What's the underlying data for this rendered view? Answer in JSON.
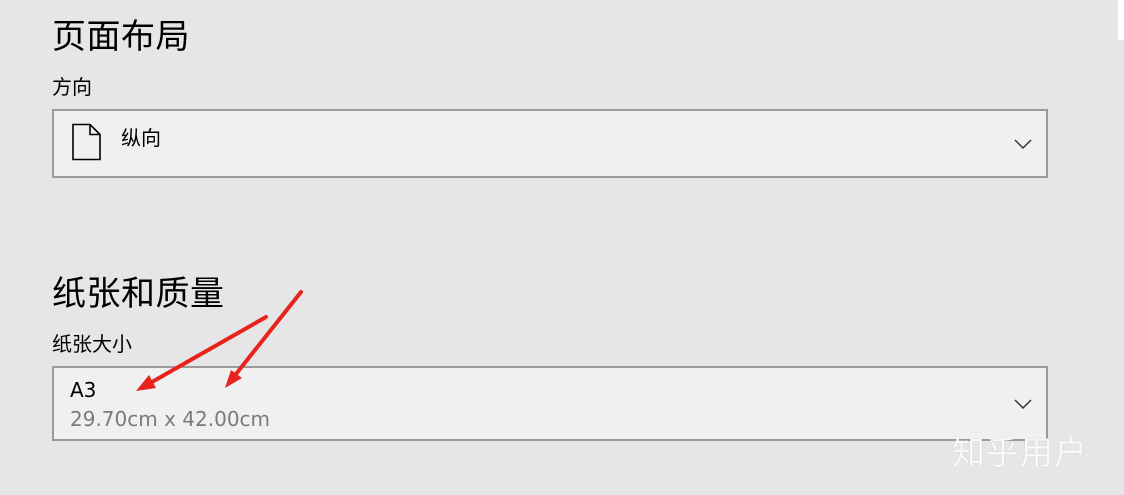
{
  "page_layout": {
    "title": "页面布局",
    "orientation": {
      "label": "方向",
      "selected": "纵向",
      "icon": "portrait-document-icon"
    }
  },
  "paper_quality": {
    "title": "纸张和质量",
    "paper_size": {
      "label": "纸张大小",
      "selected": "A3",
      "dimensions": "29.70cm x 42.00cm"
    }
  },
  "annotation": {
    "color": "#e8231c"
  },
  "watermark": "知乎用户"
}
